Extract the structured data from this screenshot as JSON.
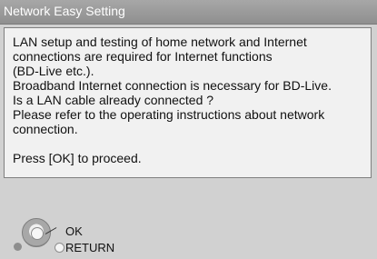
{
  "window": {
    "title": "Network Easy Setting"
  },
  "message": {
    "lines": [
      "LAN setup and testing of home network and Internet",
      "connections are required for Internet functions",
      "(BD-Live etc.).",
      "Broadband Internet connection is necessary for BD-Live.",
      "Is a LAN cable already connected ?",
      "Please refer to the operating instructions about network",
      "connection.",
      "",
      "Press [OK] to proceed."
    ]
  },
  "nav": {
    "ok_label": "OK",
    "return_label": "RETURN",
    "dpad_icon": "dpad-icon",
    "return_icon": "return-button-icon"
  }
}
